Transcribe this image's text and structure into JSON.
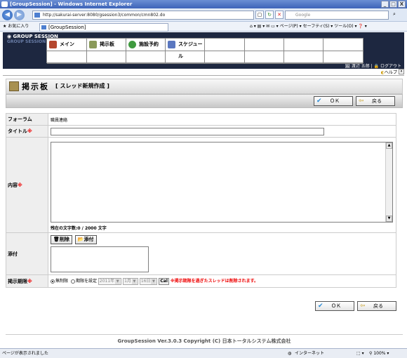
{
  "window": {
    "title": "[GroupSession] - Windows Internet Explorer",
    "minimize": "_",
    "maximize": "□",
    "close": "X"
  },
  "browser": {
    "url": "http://sakurai-server:8080/gsession3/common/cmn802.do",
    "search_placeholder": "Google",
    "favorites_label": "お気に入り",
    "tab_title": "[GroupSession]",
    "tools_menu": "ページ(P) ▾  セーフティ(S) ▾  ツール(O) ▾  ❓ ▾",
    "status_text": "ページが表示されました",
    "zone_text": "インターネット",
    "zoom_text": "100%"
  },
  "app": {
    "logo": "GROUP SESSION",
    "logo_sub": "GROUP SESSION",
    "menu": [
      {
        "label": "メイン",
        "icon": "home-icon",
        "color": "#b5472e"
      },
      {
        "label": "掲示板",
        "icon": "bulletin-icon",
        "color": "#8a9a5a"
      },
      {
        "label": "施設予約",
        "icon": "facility-icon",
        "color": "#3f9a3f"
      },
      {
        "label": "スケジュール",
        "icon": "schedule-icon",
        "color": "#5a77c0"
      }
    ],
    "user_links": "🖼 渡辺 五郎 | 🔒 ログアウト",
    "help": "ヘルプ",
    "help_close": "x"
  },
  "page": {
    "icon": "bulletin-board-icon",
    "title": "掲示板",
    "subtitle": "[ スレッド新規作成 ]",
    "ok_label": "ＯＫ",
    "back_label": "戻る",
    "ok_icon": "✔",
    "back_icon": "⇦"
  },
  "form": {
    "forum_label": "フォーラム",
    "forum_value": "職員連絡",
    "title_label": "タイトル",
    "body_label": "内容",
    "counter_label": "残在の文字数:0",
    "counter_max": "/ 2000 文字",
    "attach_label": "添付",
    "attach_delete": "削除",
    "attach_add": "添付",
    "deadline_label": "掲示期限",
    "opt_unlimited": "無制限",
    "opt_set": "期限を設定",
    "year": "2011年",
    "month": "1月",
    "day": "16日",
    "cal": "Cal",
    "warning": "※掲示期限を過ぎたスレッドは削除されます。",
    "required_mark": "※"
  },
  "footer": {
    "text": "GroupSession Ver.3.0.3 Copyright (C) 日本トータルシステム株式会社"
  }
}
